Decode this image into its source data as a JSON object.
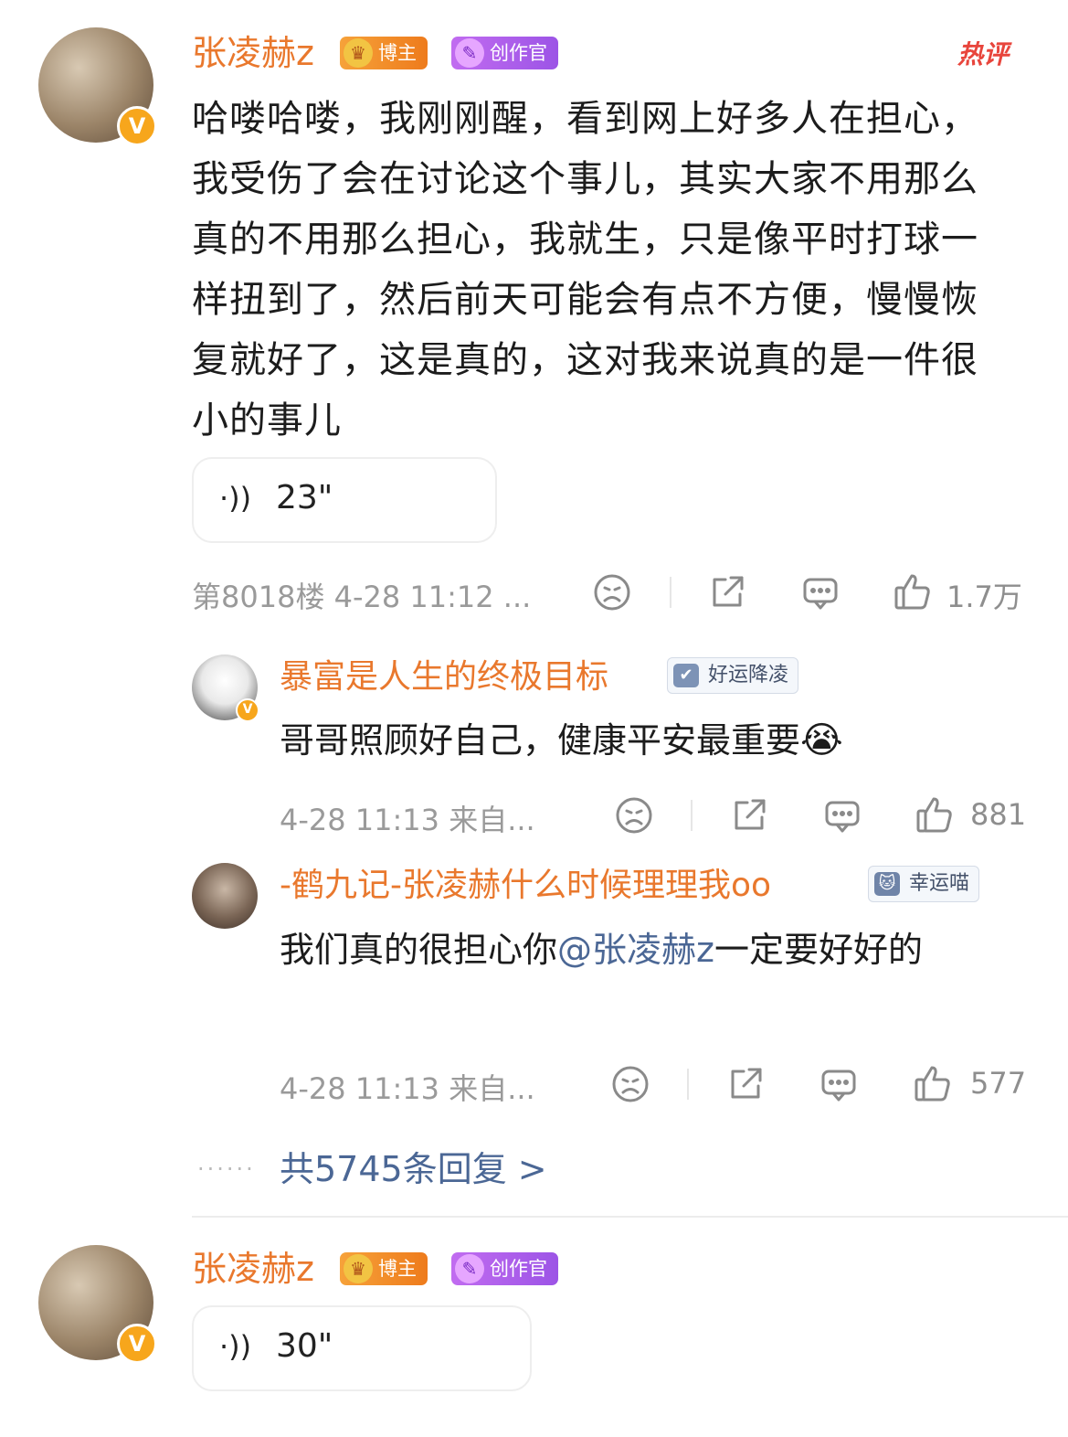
{
  "comment1": {
    "username": "张凌赫z",
    "badge_blogger": "博主",
    "badge_creator": "创作官",
    "hot_label": "热评",
    "text": "哈喽哈喽，我刚刚醒，看到网上好多人在担心，我受伤了会在讨论这个事儿，其实大家不用那么真的不用那么担心，我就生，只是像平时打球一样扭到了，然后前天可能会有点不方便，慢慢恢复就好了，这是真的，这对我来说真的是一件很小的事儿",
    "voice_duration": "23\"",
    "meta": "第8018楼 4-28 11:12 ...",
    "likes": "1.7万"
  },
  "reply1": {
    "username": "暴富是人生的终极目标",
    "badge": "好运降凌",
    "text": "哥哥照顾好自己，健康平安最重要",
    "emoji": "😭",
    "meta": "4-28 11:13 来自...",
    "likes": "881"
  },
  "reply2": {
    "username": "-鹤九记-张凌赫什么时候理理我oo",
    "badge": "幸运喵",
    "text_before": "我们真的很担心你",
    "mention": "@张凌赫z",
    "text_after": "一定要好好的",
    "meta": "4-28 11:13 来自...",
    "likes": "577"
  },
  "more_replies": {
    "dots": "......",
    "label": "共5745条回复 >"
  },
  "comment2": {
    "username": "张凌赫z",
    "badge_blogger": "博主",
    "badge_creator": "创作官",
    "voice_duration": "30\""
  },
  "icons": {
    "voice": "sound-wave-icon",
    "dislike": "sad-face-icon",
    "share": "share-icon",
    "comment": "comment-icon",
    "like": "thumbs-up-icon",
    "verified": "verified-v-icon"
  },
  "colors": {
    "username": "#e9782d",
    "link": "#4b6795",
    "meta": "#9a9a9a",
    "hot": "#e8453c"
  }
}
